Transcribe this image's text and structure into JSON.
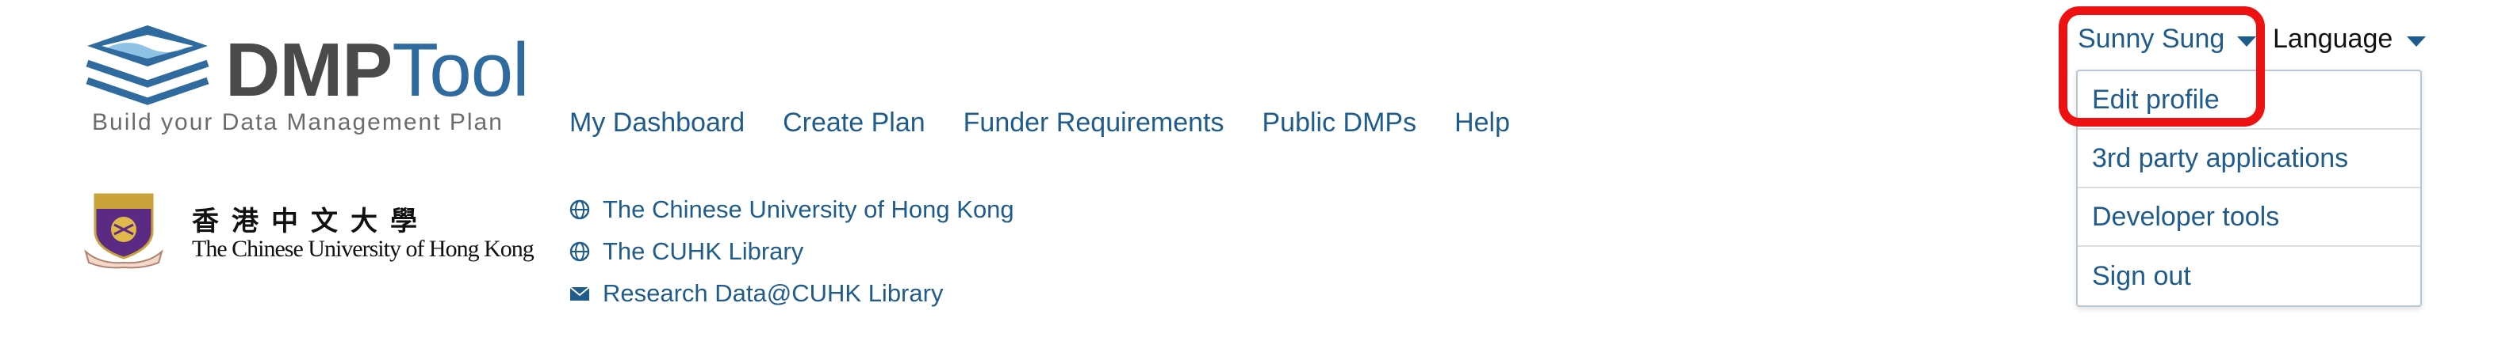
{
  "logo": {
    "wordmark_bold": "DMP",
    "wordmark_light": "Tool",
    "tagline": "Build your Data Management Plan"
  },
  "nav": {
    "items": [
      {
        "label": "My Dashboard"
      },
      {
        "label": "Create Plan"
      },
      {
        "label": "Funder Requirements"
      },
      {
        "label": "Public DMPs"
      },
      {
        "label": "Help"
      }
    ]
  },
  "institution": {
    "name_zh": "香港中文大學",
    "name_en": "The Chinese University of Hong Kong",
    "links": [
      {
        "label": "The Chinese University of Hong Kong",
        "icon": "globe-icon"
      },
      {
        "label": "The CUHK Library",
        "icon": "globe-icon"
      },
      {
        "label": "Research Data@CUHK Library",
        "icon": "envelope-icon"
      }
    ]
  },
  "user_menu": {
    "name": "Sunny Sung",
    "items": [
      {
        "label": "Edit profile"
      },
      {
        "label": "3rd party applications"
      },
      {
        "label": "Developer tools"
      },
      {
        "label": "Sign out"
      }
    ]
  },
  "language_menu": {
    "label": "Language"
  },
  "colors": {
    "link": "#1f5c8c",
    "brand_dark": "#4a4a4a",
    "brand_blue": "#2f6b9f",
    "highlight": "#ee1111"
  }
}
